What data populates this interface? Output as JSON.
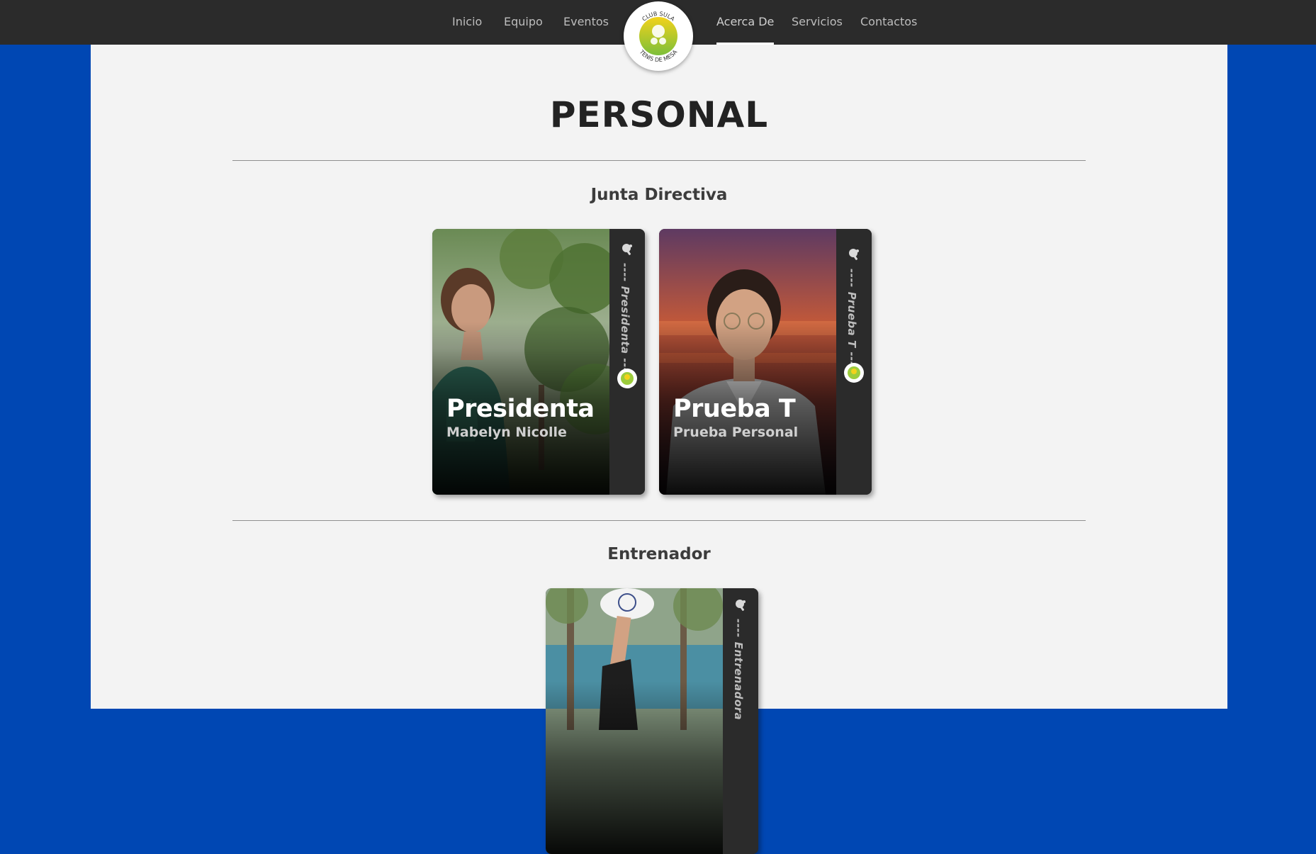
{
  "nav": {
    "items": [
      {
        "label": "Inicio"
      },
      {
        "label": "Equipo"
      },
      {
        "label": "Eventos"
      },
      {
        "label": "Acerca De",
        "active": true
      },
      {
        "label": "Servicios"
      },
      {
        "label": "Contactos"
      }
    ],
    "logo": {
      "top_text": "CLUB SULA",
      "bottom_text": "TENIS DE MESA"
    }
  },
  "page": {
    "title": "PERSONAL"
  },
  "sections": [
    {
      "title": "Junta Directiva",
      "cards": [
        {
          "role": "Presidenta",
          "name": "Mabelyn Nicolle",
          "side_label": "---- Presidenta ----"
        },
        {
          "role": "Prueba T",
          "name": "Prueba Personal",
          "side_label": "---- Prueba T ----"
        }
      ]
    },
    {
      "title": "Entrenador",
      "cards": [
        {
          "role": "",
          "name": "",
          "side_label": "---- Entrenadora"
        }
      ]
    }
  ],
  "colors": {
    "nav_bg": "#2b2b2b",
    "page_bg": "#0047b3",
    "content_bg": "#f3f3f3",
    "card_side": "#2b2b2b",
    "logo_green": "#8cc63f",
    "logo_yellow": "#f2d21b"
  }
}
